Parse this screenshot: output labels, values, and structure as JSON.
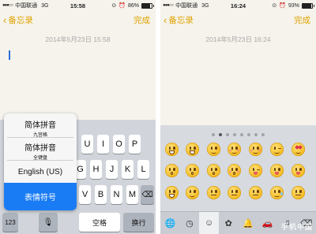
{
  "left": {
    "status": {
      "carrier": "中国联通",
      "network": "3G",
      "time": "15:58",
      "battery": "86%",
      "battery_fraction": 0.86
    },
    "nav": {
      "back_label": "备忘录",
      "done_label": "完成"
    },
    "note_date": "2014年5月23日 15:58",
    "keyboard": {
      "row1": [
        "U",
        "I",
        "O",
        "P"
      ],
      "row2": [
        "G",
        "H",
        "J",
        "K",
        "L"
      ],
      "row3": [
        "V",
        "B",
        "N",
        "M"
      ],
      "key_123": "123",
      "space_label": "空格",
      "return_label": "换行"
    },
    "language_menu": [
      {
        "main": "简体拼音",
        "sub": "九宫格"
      },
      {
        "main": "简体拼音",
        "sub": "全键盘"
      },
      {
        "main": "English (US)",
        "sub": ""
      },
      {
        "main": "表情符号",
        "sub": ""
      }
    ],
    "selected_language": "表情符号"
  },
  "right": {
    "status": {
      "carrier": "中国联通",
      "network": "3G",
      "time": "16:24",
      "battery": "93%",
      "battery_fraction": 0.93
    },
    "nav": {
      "back_label": "备忘录",
      "done_label": "完成"
    },
    "note_date": "2014年5月23日 16:24",
    "page_dots": {
      "count": 8,
      "active": 1
    },
    "emoji_categories": [
      "globe-icon",
      "clock-icon",
      "smiley-icon",
      "flower-icon",
      "bell-icon",
      "car-icon",
      "symbols-icon",
      "delete-icon"
    ],
    "watermark": "手机中国"
  },
  "colors": {
    "accent": "#e2a300",
    "selected_menu": "#1a7cf5"
  }
}
